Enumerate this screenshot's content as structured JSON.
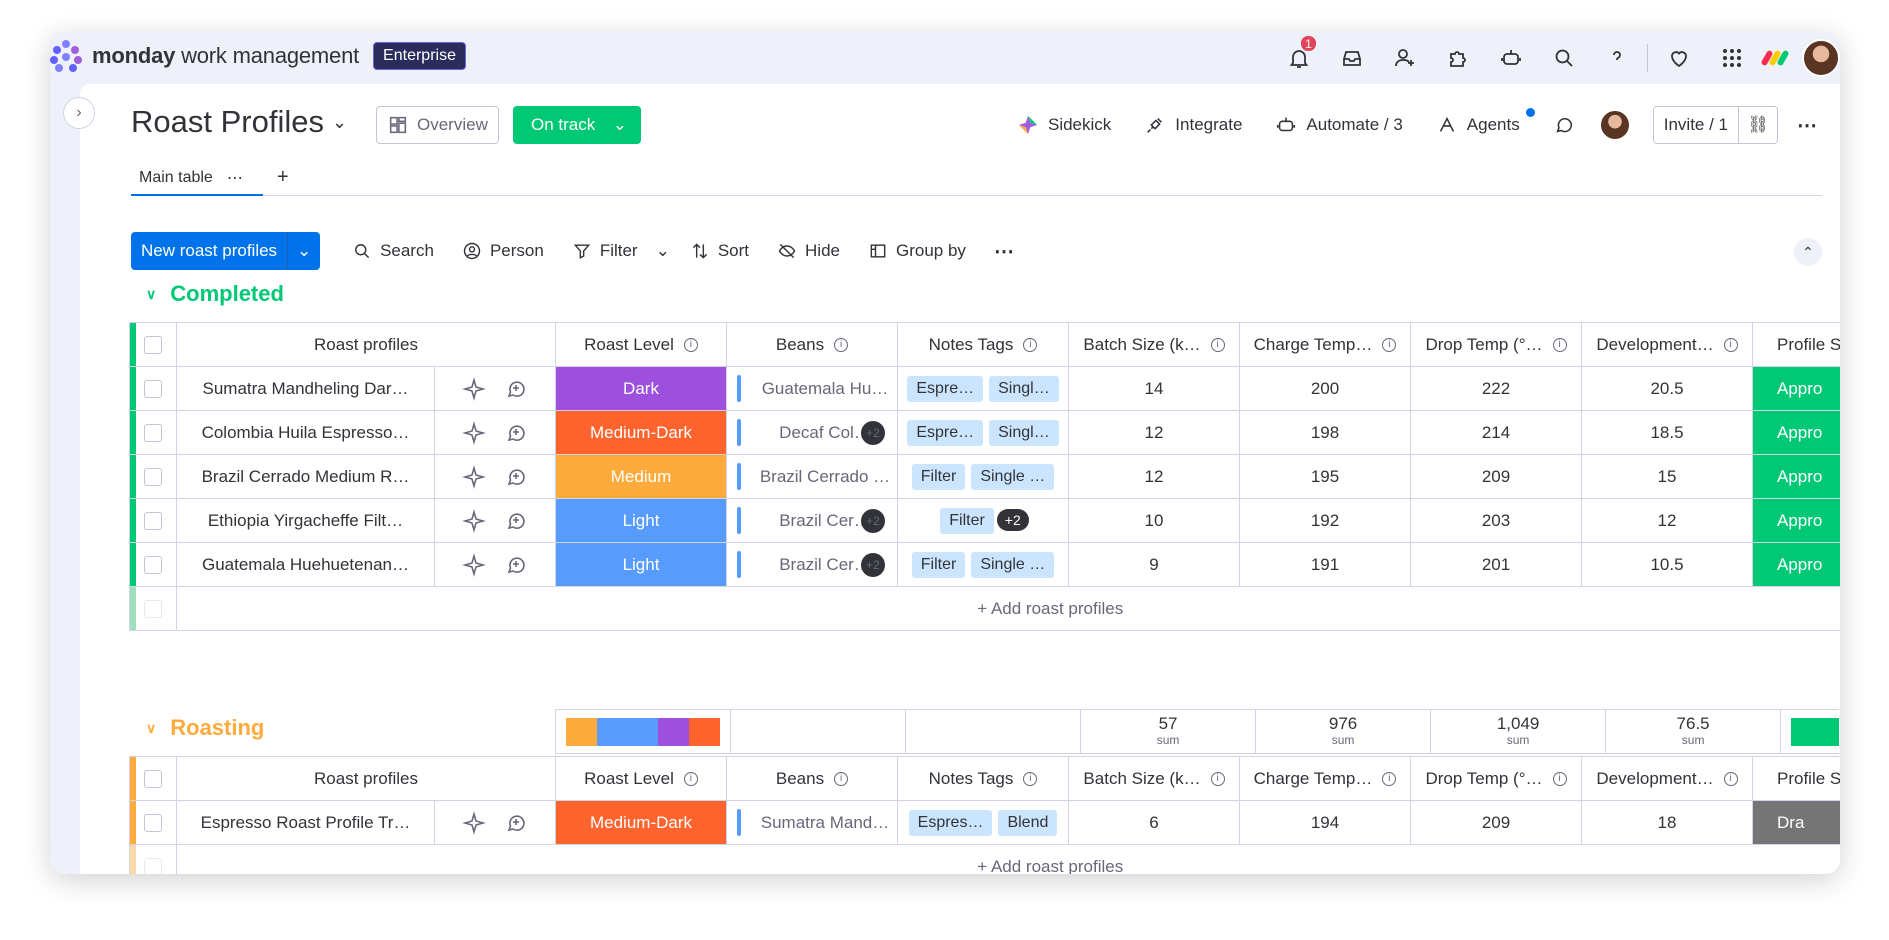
{
  "app": {
    "brand_bold": "monday",
    "brand_rest": " work management",
    "plan_badge": "Enterprise",
    "notification_count": "1"
  },
  "board": {
    "title": "Roast Profiles",
    "overview_label": "Overview",
    "status_label": "On track"
  },
  "header_actions": {
    "sidekick": "Sidekick",
    "integrate": "Integrate",
    "automate": "Automate / 3",
    "agents": "Agents",
    "invite": "Invite / 1"
  },
  "tabs": {
    "main_table": "Main table",
    "add": "+"
  },
  "toolbar": {
    "new_item": "New roast profiles",
    "search": "Search",
    "person": "Person",
    "filter": "Filter",
    "sort": "Sort",
    "hide": "Hide",
    "group_by": "Group by"
  },
  "columns": [
    "Roast profiles",
    "Roast Level",
    "Beans",
    "Notes Tags",
    "Batch Size (k…",
    "Charge Temp…",
    "Drop Temp (°…",
    "Development…",
    "Profile St"
  ],
  "colors": {
    "completed": "#00c875",
    "roasting": "#fdab3d",
    "dark": "#9d50dd",
    "medium_dark": "#ff642e",
    "medium": "#fdab3d",
    "light": "#579bfc",
    "approved": "#00c875",
    "draft": "#757575",
    "accent": "#0073ea"
  },
  "groups": [
    {
      "title": "Completed",
      "add_label": "+ Add roast profiles",
      "rows": [
        {
          "name": "Sumatra Mandheling Dar…",
          "level": "Dark",
          "beans": "Guatemala Hu…",
          "beans_more": "",
          "tags": [
            "Espre…",
            "Singl…"
          ],
          "tags_more": "",
          "batch": "14",
          "charge": "200",
          "drop": "222",
          "dev": "20.5",
          "status": "Appro"
        },
        {
          "name": "Colombia Huila Espresso…",
          "level": "Medium-Dark",
          "beans": "Decaf Col…",
          "beans_more": "+2",
          "tags": [
            "Espre…",
            "Singl…"
          ],
          "tags_more": "",
          "batch": "12",
          "charge": "198",
          "drop": "214",
          "dev": "18.5",
          "status": "Appro"
        },
        {
          "name": "Brazil Cerrado Medium R…",
          "level": "Medium",
          "beans": "Brazil Cerrado …",
          "beans_more": "",
          "tags": [
            "Filter",
            "Single …"
          ],
          "tags_more": "",
          "batch": "12",
          "charge": "195",
          "drop": "209",
          "dev": "15",
          "status": "Appro"
        },
        {
          "name": "Ethiopia Yirgacheffe Filt…",
          "level": "Light",
          "beans": "Brazil Cer…",
          "beans_more": "+2",
          "tags": [
            "Filter"
          ],
          "tags_more": "+2",
          "batch": "10",
          "charge": "192",
          "drop": "203",
          "dev": "12",
          "status": "Appro"
        },
        {
          "name": "Guatemala Huehuetenan…",
          "level": "Light",
          "beans": "Brazil Cer…",
          "beans_more": "+2",
          "tags": [
            "Filter",
            "Single …"
          ],
          "tags_more": "",
          "batch": "9",
          "charge": "191",
          "drop": "201",
          "dev": "10.5",
          "status": "Appro"
        }
      ],
      "summary": {
        "batch": "57",
        "charge": "976",
        "drop": "1,049",
        "dev": "76.5",
        "label": "sum",
        "level_distribution": [
          {
            "level": "Medium",
            "fraction": 0.2
          },
          {
            "level": "Light",
            "fraction": 0.4
          },
          {
            "level": "Dark",
            "fraction": 0.2
          },
          {
            "level": "Medium-Dark",
            "fraction": 0.2
          }
        ]
      }
    },
    {
      "title": "Roasting",
      "add_label": "+ Add roast profiles",
      "rows": [
        {
          "name": "Espresso Roast Profile Tr…",
          "level": "Medium-Dark",
          "beans": "Sumatra Mand…",
          "beans_more": "",
          "tags": [
            "Espres…",
            "Blend"
          ],
          "tags_more": "",
          "batch": "6",
          "charge": "194",
          "drop": "209",
          "dev": "18",
          "status": "Dra"
        }
      ]
    }
  ]
}
